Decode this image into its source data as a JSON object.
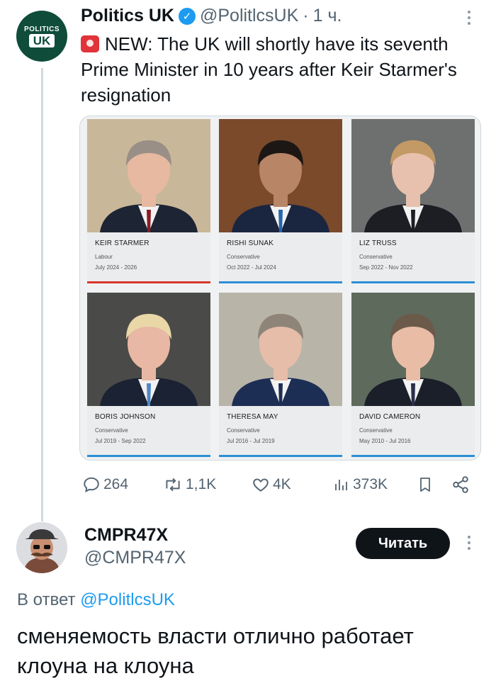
{
  "tweet": {
    "author_name": "Politics UK",
    "handle": "@PolitlcsUK",
    "separator": "·",
    "time": "1 ч.",
    "avatar_line1": "POLITICS",
    "avatar_line2": "UK",
    "text": "NEW: The UK will shortly have its seventh Prime Minister in 10 years after Keir Starmer's resignation",
    "siren_icon": "police-light-icon"
  },
  "pms": [
    {
      "name": "KEIR STARMER",
      "party": "Labour",
      "dates": "July 2024 - 2026",
      "bar_color": "#d9362b",
      "bg": "#c9b79a",
      "suit": "#1d2433",
      "skin": "#e6b9a0",
      "hair": "#9a8f86",
      "tie": "#8a1c24"
    },
    {
      "name": "RISHI SUNAK",
      "party": "Conservative",
      "dates": "Oct 2022 - Jul 2024",
      "bar_color": "#2b8fd6",
      "bg": "#7a4a2a",
      "suit": "#1a2540",
      "skin": "#b88566",
      "hair": "#1c1714",
      "tie": "#2467b0"
    },
    {
      "name": "LIZ TRUSS",
      "party": "Conservative",
      "dates": "Sep 2022 - Nov 2022",
      "bar_color": "#2b8fd6",
      "bg": "#6e7070",
      "suit": "#1c1e24",
      "skin": "#e7c1ad",
      "hair": "#c39a66",
      "tie": "#1c1e24"
    },
    {
      "name": "BORIS JOHNSON",
      "party": "Conservative",
      "dates": "Jul 2019 - Sep 2022",
      "bar_color": "#2b8fd6",
      "bg": "#4a4a48",
      "suit": "#1a2233",
      "skin": "#e8b8a4",
      "hair": "#e9d7a8",
      "tie": "#4f86c6"
    },
    {
      "name": "THERESA MAY",
      "party": "Conservative",
      "dates": "Jul 2016 - Jul 2019",
      "bar_color": "#2b8fd6",
      "bg": "#b8b4a8",
      "suit": "#1d2e55",
      "skin": "#e6bda9",
      "hair": "#8e8478",
      "tie": "#1d2e55"
    },
    {
      "name": "DAVID CAMERON",
      "party": "Conservative",
      "dates": "May 2010 - Jul 2016",
      "bar_color": "#2b8fd6",
      "bg": "#5e6a5c",
      "suit": "#1b1f2a",
      "skin": "#e9bca6",
      "hair": "#6b5a4a",
      "tie": "#2a2f4a"
    }
  ],
  "actions": {
    "replies": "264",
    "reposts": "1,1K",
    "likes": "4K",
    "views": "373K"
  },
  "reply": {
    "author_name": "CMPR47X",
    "handle": "@CMPR47X",
    "follow_label": "Читать",
    "reply_prefix": "В ответ",
    "reply_mention": "@PolitlcsUK",
    "text": "сменяемость власти отлично работает клоуна на клоуна"
  }
}
